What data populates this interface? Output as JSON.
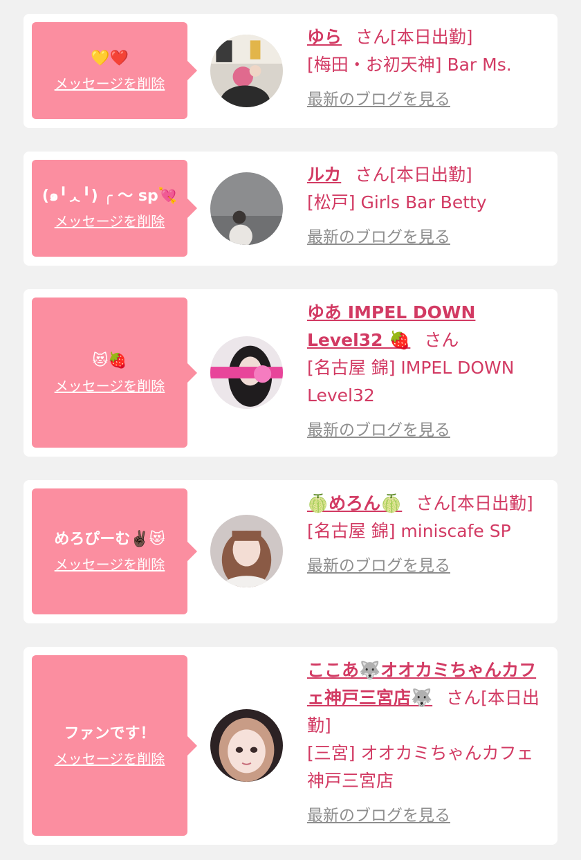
{
  "delete_label": "メッセージを削除",
  "blog_label": "最新のブログを見る",
  "cards": [
    {
      "message": "💛❤️",
      "name": "ゆら",
      "suffix": "さん[本日出勤]",
      "shop": "[梅田・お初天神] Bar Ms.",
      "avatar_icon": "avatar-photo"
    },
    {
      "message": "(๑╹ᆺ╹) ╭ 〜 sp💘",
      "name": "ルカ",
      "suffix": "さん[本日出勤]",
      "shop": "[松戸] Girls Bar Betty",
      "avatar_icon": "avatar-photo"
    },
    {
      "message": "😻🍓",
      "name": "ゆあ IMPEL DOWN Level32 🍓",
      "suffix": "さん",
      "shop": "[名古屋 錦] IMPEL DOWN Level32",
      "avatar_icon": "avatar-photo"
    },
    {
      "message": "めろぴーむ✌🏿😻",
      "name": "🍈めろん🍈",
      "suffix": "さん[本日出勤]",
      "shop": "[名古屋 錦] miniscafe SP",
      "avatar_icon": "avatar-photo"
    },
    {
      "message": "ファンです！",
      "name": "ここあ🐺オオカミちゃんカフェ神戸三宮店🐺",
      "suffix": "さん[本日出勤]",
      "shop": "[三宮] オオカミちゃんカフェ神戸三宮店",
      "avatar_icon": "avatar-photo"
    }
  ],
  "colors": {
    "accent": "#d23a63",
    "bubble": "#fb8ea0",
    "background": "#f1f1f1",
    "link_gray": "#8e8e8e"
  }
}
